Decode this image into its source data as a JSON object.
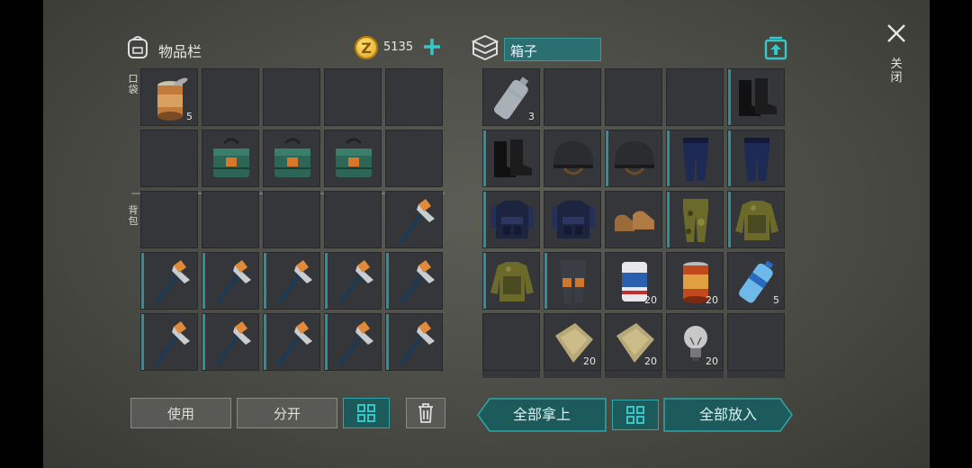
{
  "inventory": {
    "title": "物品栏",
    "coins": "5135",
    "section_pocket": "口袋",
    "section_backpack": "背包",
    "slots": [
      {
        "item": "canned-food",
        "qty": "5"
      },
      {},
      {},
      {},
      {},
      {},
      {
        "item": "ammo-box"
      },
      {
        "item": "ammo-box"
      },
      {
        "item": "ammo-box"
      },
      {},
      {},
      {},
      {},
      {},
      {
        "item": "hatchet"
      },
      {
        "item": "hatchet"
      },
      {
        "item": "hatchet"
      },
      {
        "item": "hatchet"
      },
      {
        "item": "hatchet"
      },
      {
        "item": "hatchet"
      },
      {
        "item": "hatchet"
      },
      {
        "item": "hatchet"
      },
      {
        "item": "hatchet"
      },
      {
        "item": "hatchet"
      },
      {
        "item": "hatchet"
      }
    ],
    "use_label": "使用",
    "split_label": "分开"
  },
  "box": {
    "title": "箱子",
    "slots": [
      {
        "item": "water-bottle-empty",
        "qty": "3"
      },
      {},
      {},
      {},
      {
        "item": "boots"
      },
      {
        "item": "boots"
      },
      {
        "item": "helmet"
      },
      {
        "item": "helmet"
      },
      {
        "item": "pants"
      },
      {
        "item": "pants"
      },
      {
        "item": "police-vest"
      },
      {
        "item": "police-vest"
      },
      {
        "item": "shoes"
      },
      {
        "item": "camo-pants"
      },
      {
        "item": "camo-jacket"
      },
      {
        "item": "camo-jacket"
      },
      {
        "item": "leg-armor"
      },
      {
        "item": "beer-can",
        "qty": "20"
      },
      {
        "item": "food-can",
        "qty": "20"
      },
      {
        "item": "water-bottle",
        "qty": "5"
      },
      {},
      {
        "item": "cloth",
        "qty": "20"
      },
      {
        "item": "cloth",
        "qty": "20"
      },
      {
        "item": "light-bulb",
        "qty": "20"
      },
      {}
    ],
    "take_all_label": "全部拿上",
    "put_all_label": "全部放入"
  },
  "close_label": "关闭",
  "colors": {
    "accent": "#2fa6a8",
    "coin": "#e8b52a"
  }
}
